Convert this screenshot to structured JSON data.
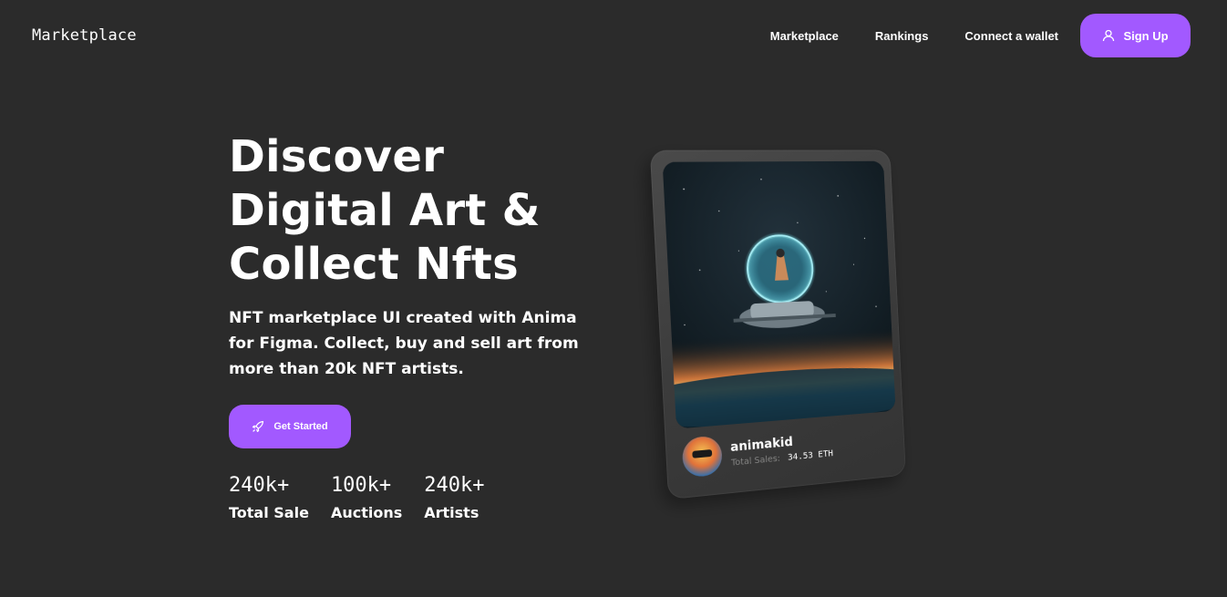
{
  "header": {
    "logo": "Marketplace",
    "nav": [
      {
        "label": "Marketplace"
      },
      {
        "label": "Rankings"
      },
      {
        "label": "Connect a wallet"
      }
    ],
    "signup_label": "Sign Up"
  },
  "hero": {
    "title_lines": [
      "Discover",
      "Digital Art &",
      "Collect Nfts"
    ],
    "subtitle": "NFT marketplace UI created with Anima for Figma. Collect, buy and sell art from more than 20k NFT artists.",
    "cta_label": "Get Started",
    "stats": [
      {
        "value": "240k+",
        "label": "Total Sale"
      },
      {
        "value": "100k+",
        "label": "Auctions"
      },
      {
        "value": "240k+",
        "label": "Artists"
      }
    ]
  },
  "card": {
    "artist": "animakid",
    "sales_label": "Total Sales:",
    "sales_value": "34.53 ETH"
  },
  "colors": {
    "background": "#2b2b2b",
    "accent": "#a259ff",
    "muted_text": "#858584"
  },
  "icons": {
    "signup": "user-icon",
    "cta": "rocket-icon"
  }
}
